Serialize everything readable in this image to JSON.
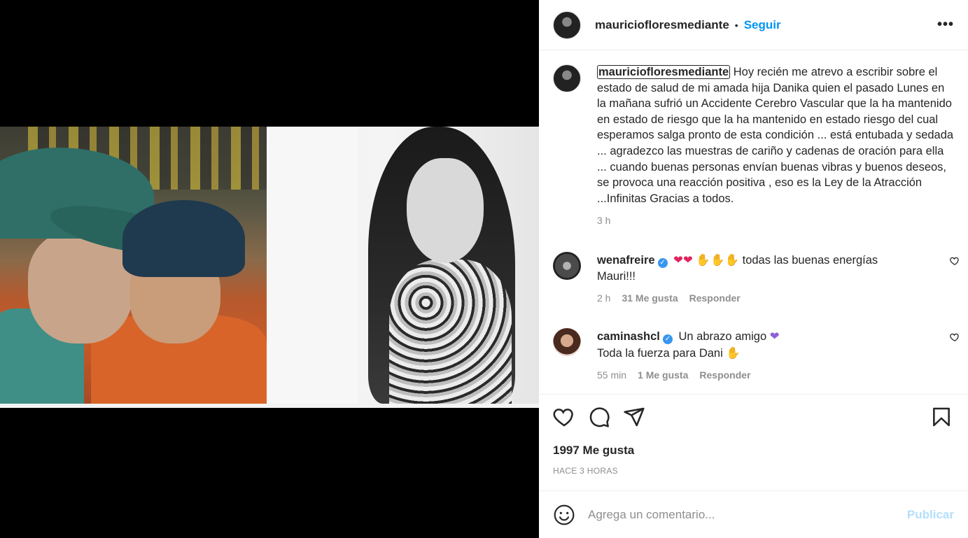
{
  "post": {
    "author": "mauriciofloresmediante",
    "separator": "•",
    "follow_label": "Seguir",
    "more_label": "•••",
    "caption_user": "mauriciofloresmediante",
    "caption_text": "Hoy recién me atrevo a escribir sobre el estado de salud de mi amada hija Danika quien el pasado Lunes en la mañana sufrió un Accidente Cerebro Vascular que la ha mantenido en estado de riesgo que la ha mantenido en estado riesgo del cual esperamos salga pronto de esta condición ... está entubada y sedada ... agradezco las muestras de cariño y cadenas de oración para ella ... cuando buenas personas envían buenas vibras y buenos deseos, se provoca una reacción positiva , eso es la Ley de la Atracción ...Infinitas Gracias a todos.",
    "caption_time": "3 h"
  },
  "comments": [
    {
      "user": "wenafreire",
      "verified": true,
      "text_line1_after": "todas las buenas energías",
      "text_line2": "Mauri!!!",
      "time": "2 h",
      "likes": "31 Me gusta",
      "reply": "Responder"
    },
    {
      "user": "caminashcl",
      "verified": true,
      "text_line1": "Un abrazo amigo",
      "text_line2": "Toda la fuerza para Dani",
      "time": "55 min",
      "likes": "1 Me gusta",
      "reply": "Responder"
    }
  ],
  "stats": {
    "likes": "1997 Me gusta",
    "ago": "HACE 3 HORAS"
  },
  "composer": {
    "placeholder": "Agrega un comentario...",
    "publish_label": "Publicar"
  },
  "icons": [
    "heart-icon",
    "comment-icon",
    "share-icon",
    "bookmark-icon",
    "smile-icon",
    "verified-icon"
  ]
}
